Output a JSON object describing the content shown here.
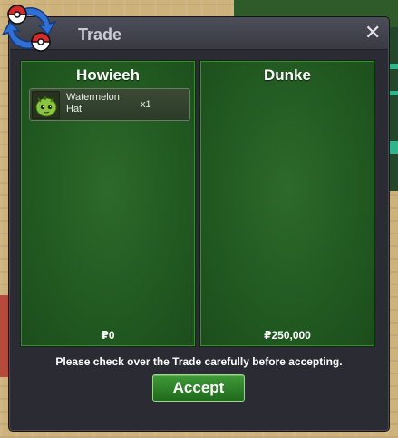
{
  "window": {
    "title": "Trade",
    "close_icon": "close-icon",
    "notice": "Please check over the Trade carefully before accepting.",
    "accept_label": "Accept"
  },
  "left_panel": {
    "player_name": "Howieeh",
    "items": [
      {
        "name": "Watermelon Hat",
        "quantity": "x1",
        "icon": "watermelon-hat-icon"
      }
    ],
    "money": "₽0"
  },
  "right_panel": {
    "player_name": "Dunke",
    "items": [],
    "money": "₽250,000"
  },
  "colors": {
    "panel_green": "#225a21",
    "window_bg": "#2a2b33",
    "accept_green": "#2f8a2b"
  }
}
